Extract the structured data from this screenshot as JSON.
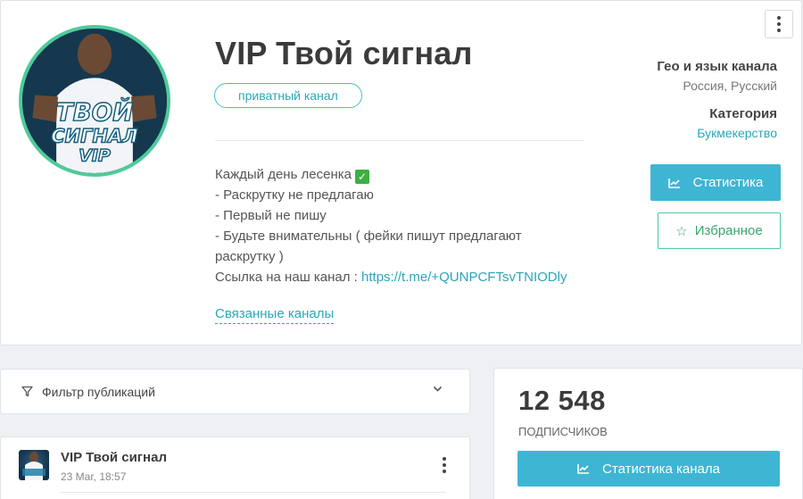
{
  "channel": {
    "title": "VIP Твой сигнал",
    "badge": "приватный канал",
    "avatar_text_1": "ТВОЙ",
    "avatar_text_2": "СИГНАЛ",
    "avatar_text_3": "VIP",
    "description": {
      "line1": "Каждый день лесенка",
      "line2": "- Раскрутку не предлагаю",
      "line3": "- Первый не пишу",
      "line4": "- Будьте внимательны ( фейки пишут предлагают",
      "line5": "раскрутку )",
      "link_prefix": "Ссылка на наш канал : ",
      "link": "https://t.me/+QUNPCFTsvTNIODly"
    },
    "related_link": "Связанные каналы"
  },
  "meta": {
    "geo_label": "Гео и язык канала",
    "geo_value": "Россия, Русский",
    "category_label": "Категория",
    "category_value": "Букмекерство"
  },
  "actions": {
    "stats_label": "Статистика",
    "favorite_label": "Избранное"
  },
  "filter": {
    "label": "Фильтр публикаций"
  },
  "post": {
    "title": "VIP Твой сигнал",
    "time": "23 Mar, 18:57"
  },
  "subscribers": {
    "count": "12 548",
    "label": "подписчиков",
    "button_label": "Статистика канала"
  },
  "colors": {
    "accent": "#3fb5d4",
    "teal_link": "#2aa7b7",
    "green": "#4ecb9a"
  }
}
